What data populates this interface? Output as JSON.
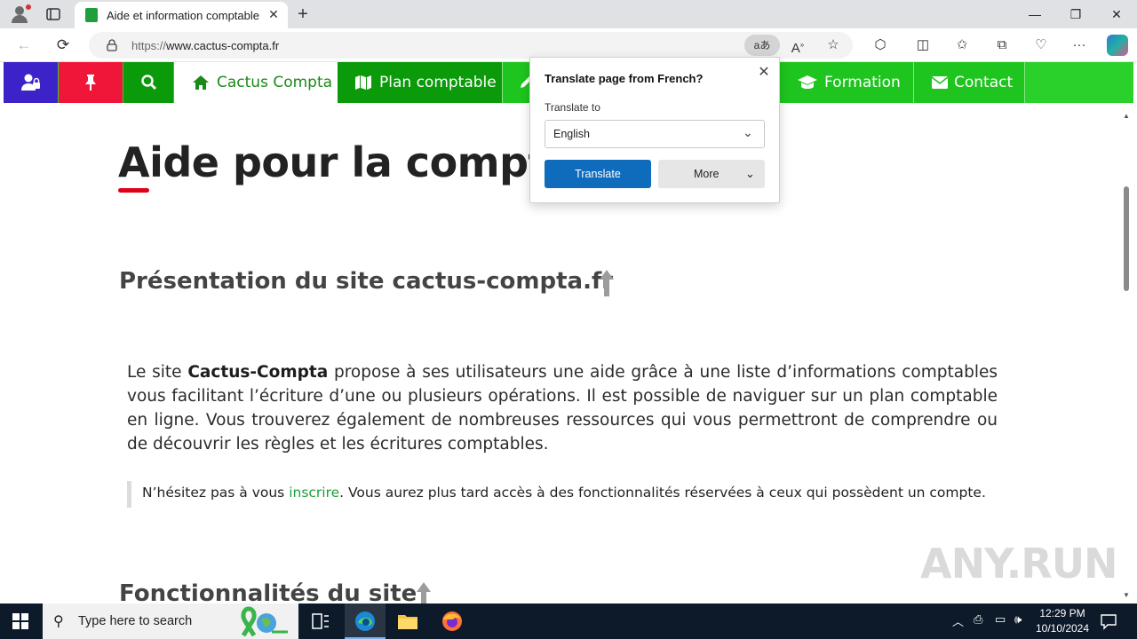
{
  "browser": {
    "tab_title": "Aide et information comptable",
    "url_protocol": "https://",
    "url_host": "www.cactus-compta.fr",
    "translate_pill_label": "aあ"
  },
  "site_menu": {
    "items": [
      {
        "label": "",
        "icon": "user-lock-icon",
        "color": "#3b22c9"
      },
      {
        "label": "",
        "icon": "thumbtack-icon",
        "color": "#f0163a"
      },
      {
        "label": "",
        "icon": "search-icon",
        "color": "#0a9a0a"
      },
      {
        "label": "Cactus Compta",
        "icon": "home-icon",
        "color": "#ffffff"
      },
      {
        "label": "Plan comptable",
        "icon": "map-icon",
        "color": "#0a9a0a"
      },
      {
        "label": "Formation",
        "icon": "graduation-cap-icon",
        "color": "#1ec51e"
      },
      {
        "label": "Contact",
        "icon": "envelope-icon",
        "color": "#1ec51e"
      }
    ]
  },
  "content": {
    "h1": "Aide pour la comptal",
    "h2": "Présentation du site cactus-compta.fr",
    "paragraph_pre": "Le site ",
    "paragraph_bold": "Cactus-Compta",
    "paragraph_post": " propose à ses utilisateurs une aide grâce à une liste d’informations comptables vous facilitant l’écriture d’une ou plusieurs opérations. Il est possible de naviguer sur un plan comptable en ligne. Vous trouverez également de nombreuses ressources qui vous permettront de comprendre ou de découvrir les règles et les écritures comptables.",
    "note_pre": "N’hésitez pas à vous ",
    "note_link": "inscrire",
    "note_post": ". Vous aurez plus tard accès à des fonctionnalités réservées à ceux qui possèdent un compte.",
    "h2_next": "Fonctionnalités du site"
  },
  "translate_popup": {
    "title": "Translate page from French?",
    "label": "Translate to",
    "selected_language": "English",
    "primary_button": "Translate",
    "secondary_button": "More"
  },
  "watermark": "ANY.RUN",
  "taskbar": {
    "search_placeholder": "Type here to search",
    "time": "12:29 PM",
    "date": "10/10/2024"
  }
}
